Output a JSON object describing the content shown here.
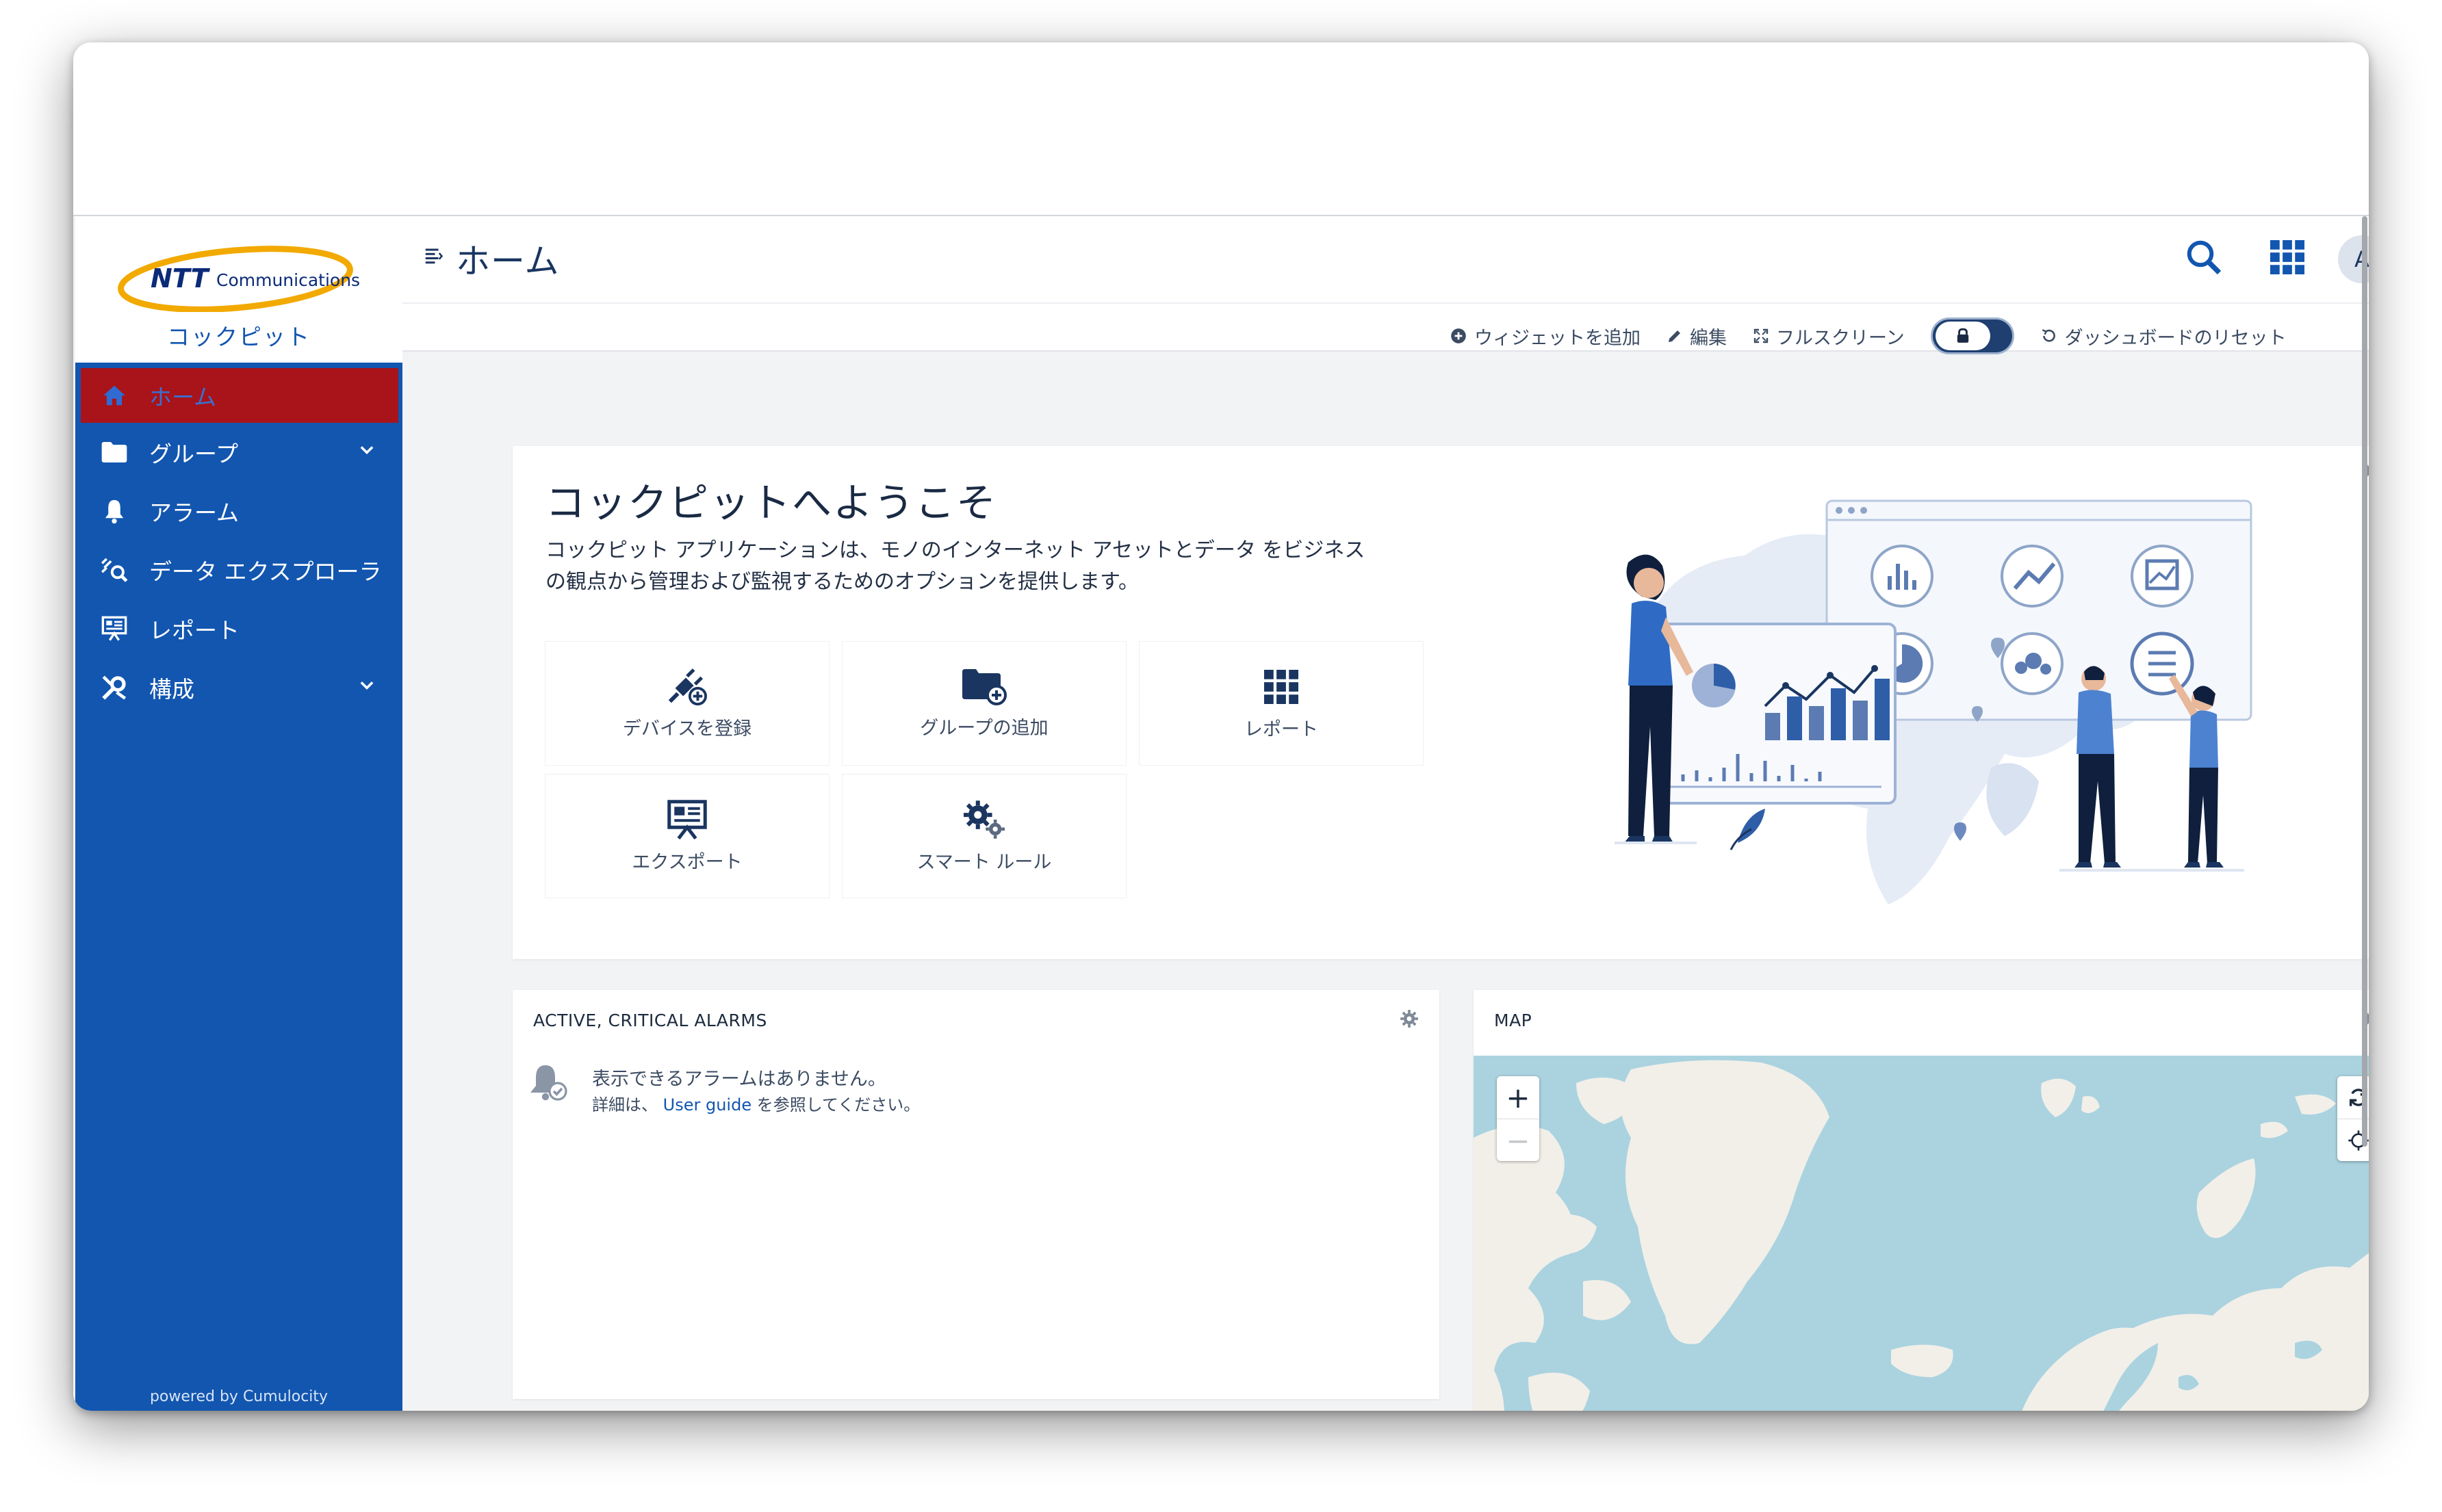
{
  "brand": {
    "logo_text": "NTT Communications",
    "app_name": "コックピット",
    "accent": "#1256b0",
    "active_color": "#a8141a"
  },
  "sidebar": {
    "items": [
      {
        "label": "ホーム",
        "icon": "home-icon",
        "active": true
      },
      {
        "label": "グループ",
        "icon": "folder-icon",
        "expandable": true
      },
      {
        "label": "アラーム",
        "icon": "bell-icon"
      },
      {
        "label": "データ エクスプローラ",
        "icon": "data-explorer-icon"
      },
      {
        "label": "レポート",
        "icon": "report-icon"
      },
      {
        "label": "構成",
        "icon": "configuration-icon",
        "expandable": true
      }
    ],
    "powered_by": "powered by Cumulocity"
  },
  "header": {
    "title": "ホーム",
    "avatar_initial": "A",
    "actions": {
      "add_widget": "ウィジェットを追加",
      "edit": "編集",
      "fullscreen": "フルスクリーン",
      "reset": "ダッシュボードのリセット"
    }
  },
  "welcome": {
    "title": "コックピットへようこそ",
    "desc_line1": "コックピット アプリケーションは、モノのインターネット アセットとデータ をビジネス",
    "desc_line2": "の観点から管理および監視するためのオプションを提供します。",
    "tiles": [
      {
        "label": "デバイスを登録",
        "icon": "plug-add-icon"
      },
      {
        "label": "グループの追加",
        "icon": "folder-add-icon"
      },
      {
        "label": "レポート",
        "icon": "grid-icon"
      },
      {
        "label": "エクスポート",
        "icon": "export-icon"
      },
      {
        "label": "スマート ルール",
        "icon": "smart-rule-icon"
      }
    ]
  },
  "alarms": {
    "title": "ACTIVE, CRITICAL ALARMS",
    "empty_message": "表示できるアラームはありません。",
    "hint_prefix": "詳細は、",
    "hint_link": "User guide",
    "hint_suffix": "を参照してください。"
  },
  "map": {
    "title": "MAP",
    "zoom_in": "+",
    "zoom_out": "−",
    "water_color": "#aad3df",
    "land_color": "#f2efe9"
  }
}
